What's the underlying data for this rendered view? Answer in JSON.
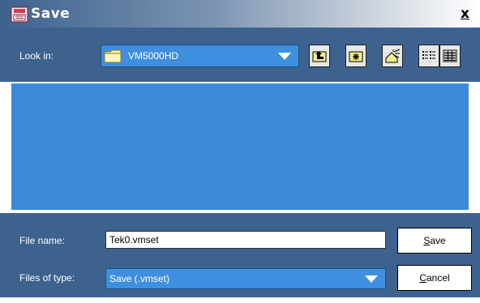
{
  "window": {
    "title": "Save",
    "close_glyph": "x"
  },
  "toolbar": {
    "lookin_label": "Look in:",
    "lookin_value": "VM5000HD",
    "buttons": [
      {
        "icon": "up-folder-icon",
        "tooltip": ""
      },
      {
        "icon": "new-folder-icon",
        "tooltip": ""
      },
      {
        "icon": "home-sparkle-icon",
        "tooltip": ""
      },
      {
        "icon": "list-view-icon",
        "tooltip": ""
      },
      {
        "icon": "details-view-icon",
        "tooltip": ""
      }
    ]
  },
  "file_list": {
    "items": []
  },
  "form": {
    "filename_label": "File name:",
    "filename_value": "Tek0.vmset",
    "filetype_label": "Files of type:",
    "filetype_value": "Save (.vmset)"
  },
  "buttons": {
    "save_mnemonic": "S",
    "save_rest": "ave",
    "cancel_mnemonic": "C",
    "cancel_rest": "ancel"
  },
  "colors": {
    "panel": "#3d628e",
    "list_area": "#3a8ad7",
    "combo": "#3f8fe0"
  }
}
